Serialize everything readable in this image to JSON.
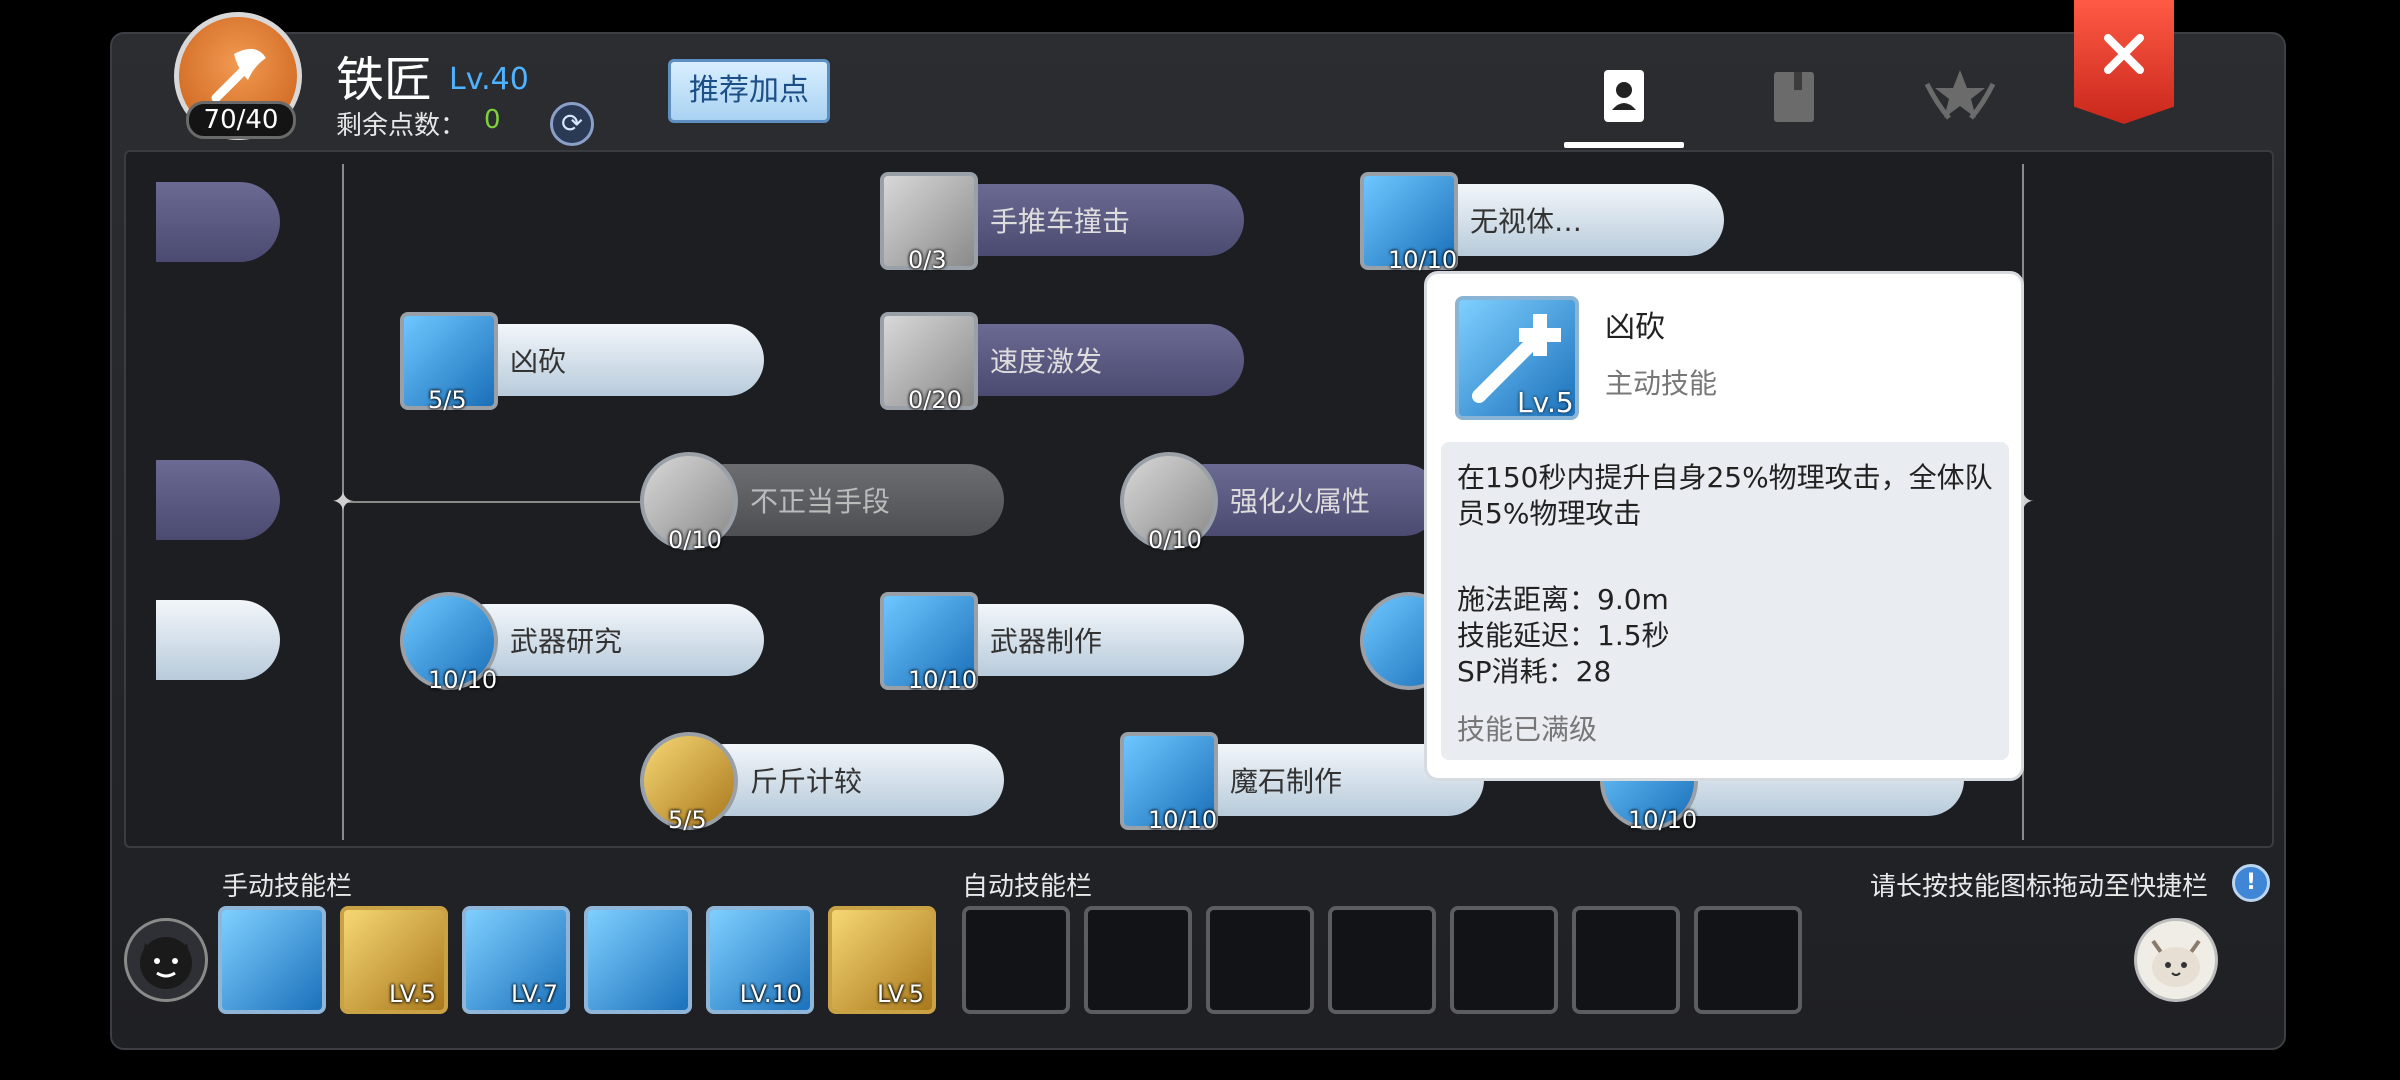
{
  "header": {
    "job_title": "铁匠",
    "job_level": "Lv.40",
    "points_label": "剩余点数：",
    "points_value": "0",
    "avatar_count": "70/40",
    "recommend_label": "推荐加点",
    "tabs": [
      "skills-tab",
      "book-tab",
      "emblem-tab"
    ]
  },
  "skills": [
    {
      "name": "手推车撞击",
      "count": "0/3"
    },
    {
      "name": "无视体…",
      "count": "10/10"
    },
    {
      "name": "凶砍",
      "count": "5/5"
    },
    {
      "name": "速度激发",
      "count": "0/20"
    },
    {
      "name": "不正当手段",
      "count": "0/10"
    },
    {
      "name": "强化火属性",
      "count": "0/10"
    },
    {
      "name": "武器研究",
      "count": "10/10"
    },
    {
      "name": "武器制作",
      "count": "10/10"
    },
    {
      "name": "斤斤计较",
      "count": "5/5"
    },
    {
      "name": "魔石制作",
      "count": "10/10"
    },
    {
      "name": "",
      "count": "10/10"
    }
  ],
  "tooltip": {
    "name": "凶砍",
    "level": "Lv.5",
    "type": "主动技能",
    "description": "在150秒内提升自身25%物理攻击，全体队员5%物理攻击",
    "cast_range": "施法距离：9.0m",
    "delay": "技能延迟：1.5秒",
    "sp_cost": "SP消耗：28",
    "max_note": "技能已满级"
  },
  "bottom": {
    "manual_label": "手动技能栏",
    "auto_label": "自动技能栏",
    "help_text": "请长按技能图标拖动至快捷栏",
    "info_glyph": "!",
    "manual_slots": [
      {
        "level": ""
      },
      {
        "level": "LV.5"
      },
      {
        "level": "LV.7"
      },
      {
        "level": ""
      },
      {
        "level": "LV.10"
      },
      {
        "level": "LV.5"
      }
    ]
  },
  "colors": {
    "accent_blue": "#4fb3ff",
    "points_green": "#7ed13b",
    "close_red": "#d9301f"
  }
}
